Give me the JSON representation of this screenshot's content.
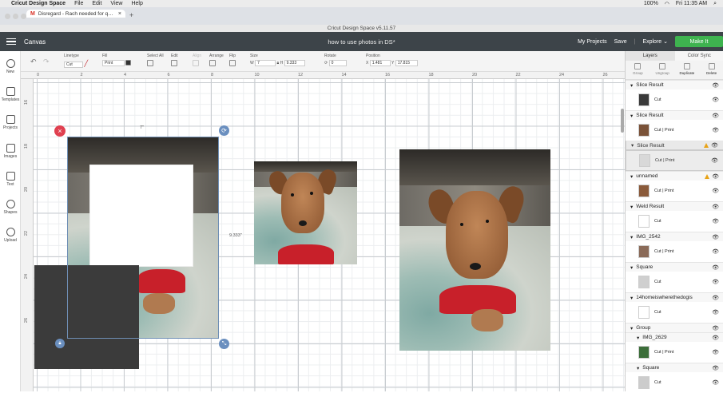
{
  "menubar": {
    "app_name": "Cricut Design Space",
    "items": [
      "File",
      "Edit",
      "View",
      "Help"
    ],
    "battery": "100%",
    "clock": "Fri 11:35 AM"
  },
  "browser": {
    "tab_label": "Disregard - Rach needed for q…",
    "window_title": "Cricut Design Space  v5.11.57"
  },
  "header": {
    "canvas_label": "Canvas",
    "doc_title": "how to use photos in DS*",
    "my_projects": "My Projects",
    "save": "Save",
    "explore": "Explore",
    "make_it": "Make It"
  },
  "toolbar": {
    "linetype_label": "Linetype",
    "linetype_value": "Cut",
    "fill_label": "Fill",
    "fill_value": "Print",
    "select_all_label": "Select All",
    "edit_label": "Edit",
    "align_label": "Align",
    "arrange_label": "Arrange",
    "flip_label": "Flip",
    "size_label": "Size",
    "w_label": "W",
    "w_value": "7",
    "h_label": "H",
    "h_value": "9.333",
    "rotate_label": "Rotate",
    "rotate_value": "0",
    "position_label": "Position",
    "x_label": "X",
    "x_value": "1.481",
    "y_label": "Y",
    "y_value": "17.815"
  },
  "sidebar": {
    "items": [
      {
        "label": "New",
        "icon": "plus-icon"
      },
      {
        "label": "Templates",
        "icon": "shirt-icon"
      },
      {
        "label": "Projects",
        "icon": "projects-icon"
      },
      {
        "label": "Images",
        "icon": "images-icon"
      },
      {
        "label": "Text",
        "icon": "text-icon"
      },
      {
        "label": "Shapes",
        "icon": "shapes-icon"
      },
      {
        "label": "Upload",
        "icon": "upload-icon"
      }
    ]
  },
  "ruler": {
    "top_ticks": [
      "0",
      "2",
      "4",
      "6",
      "8",
      "10",
      "12",
      "14",
      "16",
      "18",
      "20",
      "22",
      "24",
      "26"
    ],
    "left_ticks": [
      "16",
      "18",
      "20",
      "22",
      "24",
      "26"
    ]
  },
  "canvas": {
    "width_dim": "7\"",
    "height_dim": "9.333\""
  },
  "layers_panel": {
    "tab_layers": "Layers",
    "tab_color_sync": "Color Sync",
    "actions": [
      "Group",
      "Ungroup",
      "Duplicate",
      "Delete"
    ],
    "layers": [
      {
        "title": "Slice Result",
        "detail": "Cut",
        "warn": false,
        "thumb_color": "#3a3a3a"
      },
      {
        "title": "Slice Result",
        "detail": "Cut  |  Print",
        "warn": false,
        "thumb_color": "#7a5238"
      },
      {
        "title": "Slice Result",
        "detail": "Cut  |  Print",
        "warn": true,
        "thumb_color": "#d8d8d8"
      },
      {
        "title": "unnamed",
        "detail": "Cut  |  Print",
        "warn": true,
        "thumb_color": "#8a5a3a"
      },
      {
        "title": "Weld Result",
        "detail": "Cut",
        "warn": false,
        "thumb_color": "#ffffff"
      },
      {
        "title": "IMG_2542",
        "detail": "Cut  |  Print",
        "warn": false,
        "thumb_color": "#8a6a58"
      },
      {
        "title": "Square",
        "detail": "Cut",
        "warn": false,
        "thumb_color": "#cfcfcf"
      },
      {
        "title": "14homeiswherethedogis",
        "detail": "Cut",
        "warn": false,
        "thumb_color": "#ffffff"
      }
    ],
    "group_title": "Group",
    "group_children": [
      {
        "title": "IMG_2629",
        "detail": "Cut  |  Print",
        "thumb_color": "#3c6e3a"
      },
      {
        "title": "Square",
        "detail": "Cut",
        "thumb_color": "#cccccc"
      }
    ]
  },
  "colors": {
    "header_bg": "#3d4449",
    "make_it_green": "#3eb34f",
    "delete_red": "#e04050",
    "handle_blue": "#6a8fbf",
    "warning": "#e8a317"
  }
}
